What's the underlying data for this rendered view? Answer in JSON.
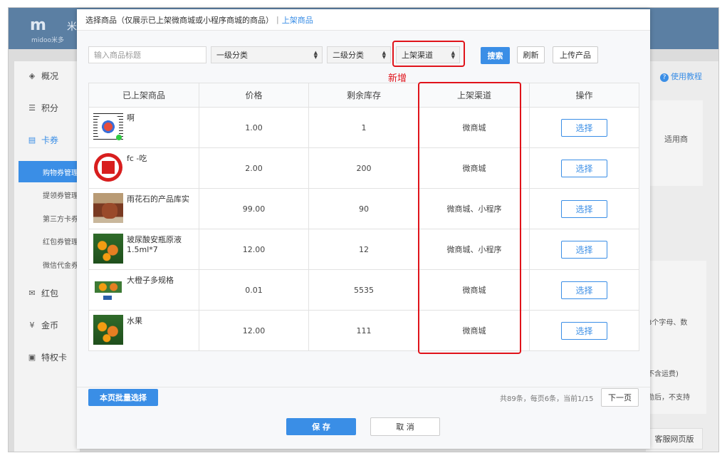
{
  "app": {
    "logo_mark": "m",
    "logo_text": "midoo米多",
    "logo_brand": "米"
  },
  "sidebar": {
    "items": [
      {
        "label": "概况",
        "icon": "layers-icon"
      },
      {
        "label": "积分",
        "icon": "database-icon"
      },
      {
        "label": "卡券",
        "icon": "ticket-icon"
      },
      {
        "label": "红包",
        "icon": "envelope-icon"
      },
      {
        "label": "金币",
        "icon": "coin-icon"
      },
      {
        "label": "特权卡",
        "icon": "card-icon"
      }
    ],
    "subitems": [
      "购物券管理",
      "提领券管理",
      "第三方卡券",
      "红包券管理",
      "微信代金券"
    ]
  },
  "background": {
    "help_link": "使用教程",
    "applicable": "适用商",
    "hint1": "8个字母、数",
    "hint2": "不含运费)",
    "hint3": "勋后，不支持",
    "service": "客服网页版"
  },
  "modal": {
    "title": "选择商品（仅展示已上架微商城或小程序商城的商品）",
    "separator": "|",
    "title_link": "上架商品",
    "search_placeholder": "输入商品标题",
    "category1": "一级分类",
    "category2": "二级分类",
    "channel": "上架渠道",
    "search_btn": "搜索",
    "refresh_btn": "刷新",
    "upload_btn": "上传产品",
    "new_tag": "新增",
    "columns": [
      "已上架商品",
      "价格",
      "剩余库存",
      "上架渠道",
      "操作"
    ],
    "rows": [
      {
        "name": "啊",
        "price": "1.00",
        "stock": "1",
        "channel": "微商城",
        "action": "选择",
        "thumb": "qr-code-thumbnail"
      },
      {
        "name": "fc -吃",
        "price": "2.00",
        "stock": "200",
        "channel": "微商城",
        "action": "选择",
        "thumb": "red-seal-thumbnail"
      },
      {
        "name": "雨花石的产品库实",
        "price": "99.00",
        "stock": "90",
        "channel": "微商城、小程序",
        "action": "选择",
        "thumb": "pottery-thumbnail"
      },
      {
        "name": "玻尿酸安瓶原液1.5ml*7",
        "price": "12.00",
        "stock": "12",
        "channel": "微商城、小程序",
        "action": "选择",
        "thumb": "orange-tree-thumbnail"
      },
      {
        "name": "大橙子多规格",
        "price": "0.01",
        "stock": "5535",
        "channel": "微商城",
        "action": "选择",
        "thumb": "orange-poster-thumbnail"
      },
      {
        "name": "水果",
        "price": "12.00",
        "stock": "111",
        "channel": "微商城",
        "action": "选择",
        "thumb": "orange-tree-thumbnail"
      }
    ],
    "batch_btn": "本页批量选择",
    "page_info": "共89条，每页6条，当前1/15",
    "next_btn": "下一页",
    "save_btn": "保 存",
    "cancel_btn": "取 消"
  },
  "colors": {
    "accent": "#3a8ee6",
    "highlight": "#e0131a",
    "topbar": "#5b7fa3"
  }
}
